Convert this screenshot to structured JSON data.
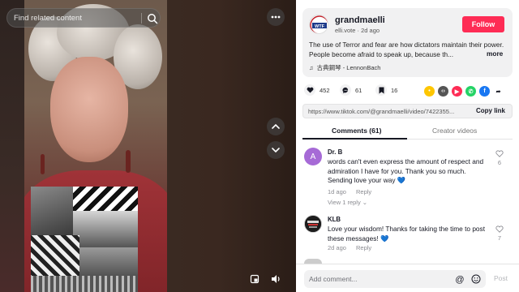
{
  "video": {
    "search_placeholder": "Find related content"
  },
  "post": {
    "avatar_text": "WTF",
    "username": "grandmaelli",
    "subline": "elli.vote · 2d ago",
    "follow_label": "Follow",
    "caption": "The use of Terror and fear are how dictators maintain their power. People become afraid to speak up, because th...",
    "caption_more": "more",
    "music_icon": "♫",
    "music": "古典鋼琴 - LennonBach"
  },
  "stats": {
    "likes": "452",
    "comments": "61",
    "saves": "16"
  },
  "share_icons": [
    {
      "name": "embed-share-icon",
      "color": "#fec600",
      "glyph": "•"
    },
    {
      "name": "code-embed-icon",
      "color": "#555555",
      "glyph": "‹›"
    },
    {
      "name": "paper-plane-icon",
      "color": "#fe2c55",
      "glyph": "▶"
    },
    {
      "name": "whatsapp-icon",
      "color": "#25d366",
      "glyph": "✆"
    },
    {
      "name": "facebook-icon",
      "color": "#1877f2",
      "glyph": "f"
    },
    {
      "name": "forward-icon",
      "color": "#ffffff",
      "glyph": "➦"
    }
  ],
  "link": {
    "url": "https://www.tiktok.com/@grandmaelli/video/7422355...",
    "copy_label": "Copy link"
  },
  "tabs": {
    "comments": "Comments (61)",
    "creator": "Creator videos"
  },
  "comments": [
    {
      "avatar_letter": "A",
      "avatar_color": "#a66ad6",
      "name": "Dr. B",
      "text": "words can't even express the amount of respect and admiration I have for you. Thank you so much. Sending love your way 💙",
      "time": "1d ago",
      "reply": "Reply",
      "likes": "6",
      "view_replies": "View 1 reply ⌄"
    },
    {
      "avatar_letter": "",
      "avatar_color": "#1d1d1d",
      "name": "KLB",
      "text": "Love your wisdom! Thanks for taking the time to post these messages! 💙",
      "time": "2d ago",
      "reply": "Reply",
      "likes": "7"
    }
  ],
  "comment_bar": {
    "placeholder": "Add comment...",
    "at": "@",
    "post": "Post"
  }
}
